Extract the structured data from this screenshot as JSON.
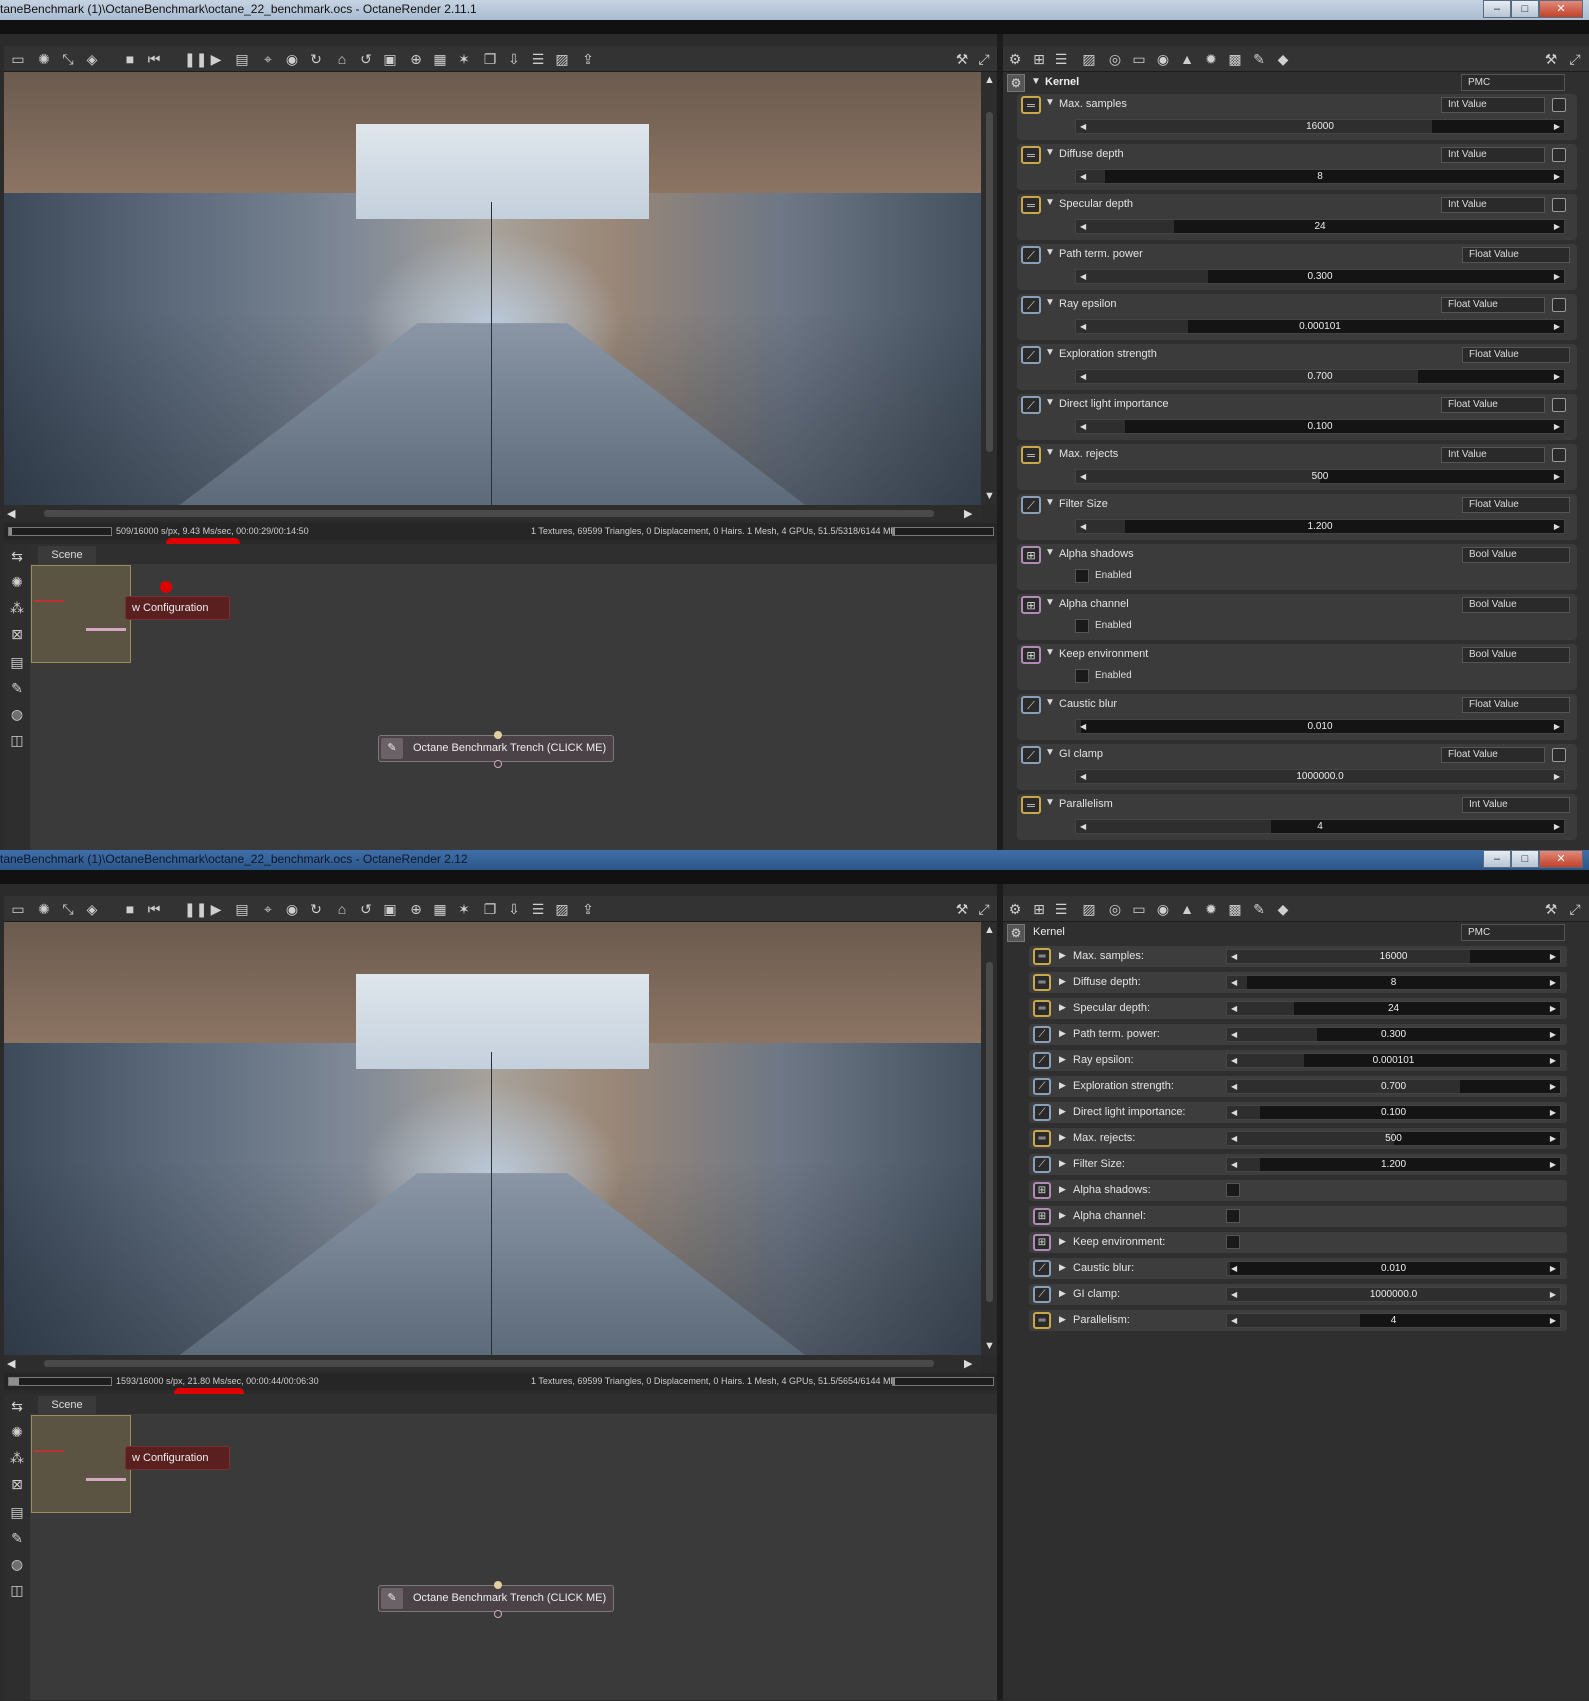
{
  "window1": {
    "title": "taneBenchmark (1)\\OctaneBenchmark\\octane_22_benchmark.ocs - OctaneRender 2.11.1",
    "status": {
      "left": "509/16000 s/px, 9.43 Ms/sec, 00:00:29/00:14:50",
      "right": "1 Textures, 69599 Triangles, 0 Displacement, 0 Hairs. 1 Mesh, 4 GPUs, 51.5/5318/6144 MB",
      "progress": 0.03
    },
    "scene_tab": "Scene",
    "config_node": "w Configuration",
    "bench_node": "Octane Benchmark Trench (CLICK ME)",
    "kernel": {
      "label": "Kernel",
      "type": "PMC"
    },
    "props": [
      {
        "name": "Max. samples",
        "type": "Int Value",
        "kind": "int",
        "value": "16000",
        "fill": 0.73,
        "curve": true
      },
      {
        "name": "Diffuse depth",
        "type": "Int Value",
        "kind": "int",
        "value": "8",
        "fill": 0.06,
        "curve": true
      },
      {
        "name": "Specular depth",
        "type": "Int Value",
        "kind": "int",
        "value": "24",
        "fill": 0.2,
        "curve": true
      },
      {
        "name": "Path term. power",
        "type": "Float Value",
        "kind": "float",
        "value": "0.300",
        "fill": 0.27,
        "curve": false
      },
      {
        "name": "Ray epsilon",
        "type": "Float Value",
        "kind": "float",
        "value": "0.000101",
        "fill": 0.23,
        "curve": true
      },
      {
        "name": "Exploration strength",
        "type": "Float Value",
        "kind": "float",
        "value": "0.700",
        "fill": 0.7,
        "curve": false
      },
      {
        "name": "Direct light importance",
        "type": "Float Value",
        "kind": "float",
        "value": "0.100",
        "fill": 0.1,
        "curve": true
      },
      {
        "name": "Max. rejects",
        "type": "Int Value",
        "kind": "int",
        "value": "500",
        "fill": 0.5,
        "curve": true
      },
      {
        "name": "Filter Size",
        "type": "Float Value",
        "kind": "float",
        "value": "1.200",
        "fill": 0.1,
        "curve": false
      },
      {
        "name": "Alpha shadows",
        "type": "Bool Value",
        "kind": "bool",
        "label": "Enabled"
      },
      {
        "name": "Alpha channel",
        "type": "Bool Value",
        "kind": "bool",
        "label": "Enabled"
      },
      {
        "name": "Keep environment",
        "type": "Bool Value",
        "kind": "bool",
        "label": "Enabled"
      },
      {
        "name": "Caustic blur",
        "type": "Float Value",
        "kind": "float",
        "value": "0.010",
        "fill": 0.01,
        "curve": false
      },
      {
        "name": "GI clamp",
        "type": "Float Value",
        "kind": "float",
        "value": "1000000.0",
        "fill": 1.0,
        "curve": true
      },
      {
        "name": "Parallelism",
        "type": "Int Value",
        "kind": "int",
        "value": "4",
        "fill": 0.4,
        "curve": false
      }
    ]
  },
  "window2": {
    "title": "taneBenchmark (1)\\OctaneBenchmark\\octane_22_benchmark.ocs - OctaneRender 2.12",
    "status": {
      "left": "1593/16000 s/px, 21.80 Ms/sec, 00:00:44/00:06:30",
      "right": "1 Textures, 69599 Triangles, 0 Displacement, 0 Hairs. 1 Mesh, 4 GPUs, 51.5/5654/6144 MB",
      "progress": 0.1
    },
    "scene_tab": "Scene",
    "config_node": "w Configuration",
    "bench_node": "Octane Benchmark Trench (CLICK ME)",
    "kernel": {
      "label": "Kernel",
      "type": "PMC"
    },
    "props": [
      {
        "name": "Max. samples:",
        "kind": "int",
        "value": "16000",
        "fill": 0.73
      },
      {
        "name": "Diffuse depth:",
        "kind": "int",
        "value": "8",
        "fill": 0.06
      },
      {
        "name": "Specular depth:",
        "kind": "int",
        "value": "24",
        "fill": 0.2
      },
      {
        "name": "Path term. power:",
        "kind": "float",
        "value": "0.300",
        "fill": 0.27
      },
      {
        "name": "Ray epsilon:",
        "kind": "float",
        "value": "0.000101",
        "fill": 0.23
      },
      {
        "name": "Exploration strength:",
        "kind": "float",
        "value": "0.700",
        "fill": 0.7
      },
      {
        "name": "Direct light importance:",
        "kind": "float",
        "value": "0.100",
        "fill": 0.1
      },
      {
        "name": "Max. rejects:",
        "kind": "int",
        "value": "500",
        "fill": 0.5
      },
      {
        "name": "Filter Size:",
        "kind": "float",
        "value": "1.200",
        "fill": 0.1
      },
      {
        "name": "Alpha shadows:",
        "kind": "bool"
      },
      {
        "name": "Alpha channel:",
        "kind": "bool"
      },
      {
        "name": "Keep environment:",
        "kind": "bool"
      },
      {
        "name": "Caustic blur:",
        "kind": "float",
        "value": "0.010",
        "fill": 0.01
      },
      {
        "name": "GI clamp:",
        "kind": "float",
        "value": "1000000.0",
        "fill": 1.0
      },
      {
        "name": "Parallelism:",
        "kind": "int",
        "value": "4",
        "fill": 0.4
      }
    ]
  },
  "window_buttons": {
    "min": "–",
    "max": "□",
    "close": "✕"
  },
  "icons": {
    "int": "═",
    "float": "⟋",
    "bool": "⊞",
    "expanded": "▼",
    "collapsed": "▶",
    "left": "◀",
    "right": "▶",
    "up": "▲",
    "down": "▼",
    "dropdown": "⌄"
  },
  "colors": {
    "int_border": "#c9a84a",
    "float_border": "#8aa0b8",
    "bool_border": "#b18ab6",
    "highlight": "#e00000"
  }
}
